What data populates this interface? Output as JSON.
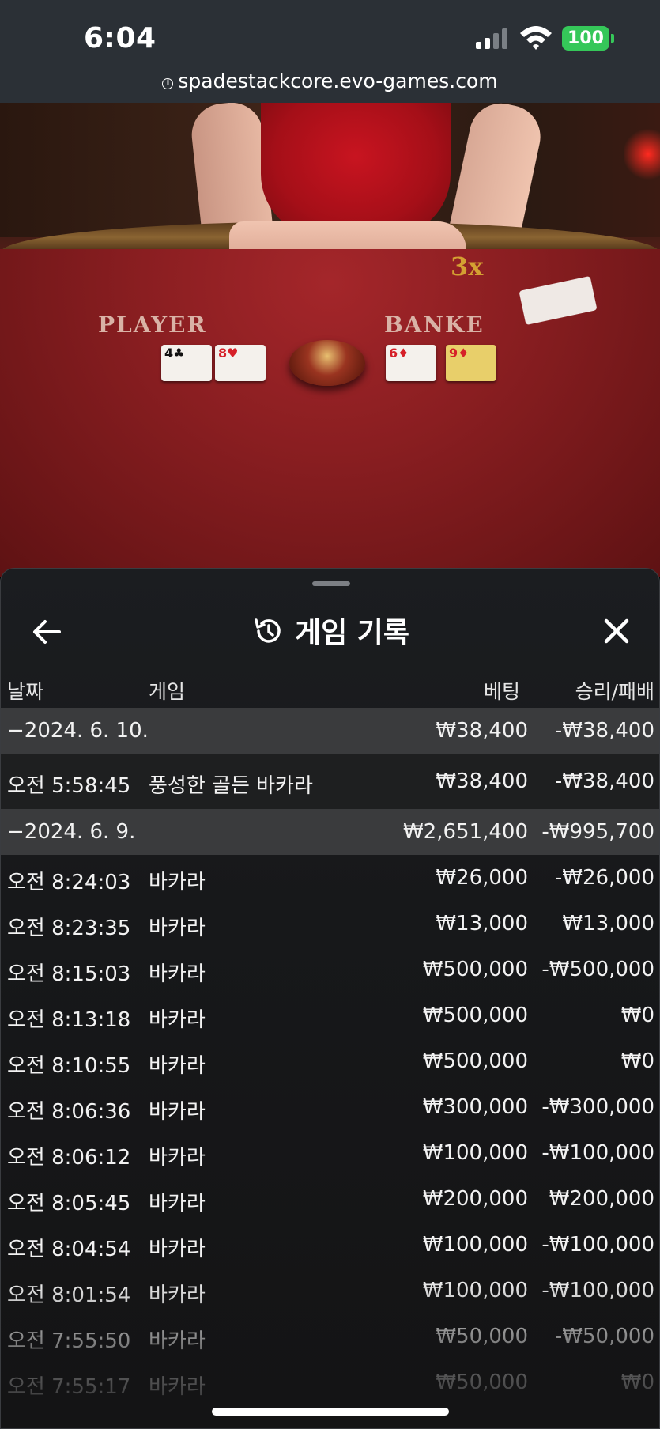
{
  "status_bar": {
    "time": "6:04",
    "battery": "100",
    "url": "spadestackcore.evo-games.com",
    "battery_color": "#35c759"
  },
  "scene": {
    "player_label": "PLAYER",
    "banker_label": "BANKE",
    "multiplier": "3x",
    "player_cards": [
      "4♣",
      "8♥"
    ],
    "banker_cards": [
      "6♦",
      "9♦"
    ]
  },
  "panel": {
    "title": "게임 기록",
    "back_icon": "arrow-left-icon",
    "close_icon": "close-icon",
    "history_icon": "history-icon",
    "columns": {
      "date": "날짜",
      "game": "게임",
      "bet": "베팅",
      "result": "승리/패배"
    },
    "days": [
      {
        "date": "−2024. 6. 10.",
        "bet": "₩38,400",
        "result": "-₩38,400",
        "rows": [
          {
            "time": "오전 5:58:45",
            "game": "풍성한 골든 바카라",
            "bet": "₩38,400",
            "result": "-₩38,400"
          }
        ]
      },
      {
        "date": "−2024. 6. 9.",
        "bet": "₩2,651,400",
        "result": "-₩995,700",
        "rows": [
          {
            "time": "오전 8:24:03",
            "game": "바카라",
            "bet": "₩26,000",
            "result": "-₩26,000"
          },
          {
            "time": "오전 8:23:35",
            "game": "바카라",
            "bet": "₩13,000",
            "result": "₩13,000"
          },
          {
            "time": "오전 8:15:03",
            "game": "바카라",
            "bet": "₩500,000",
            "result": "-₩500,000"
          },
          {
            "time": "오전 8:13:18",
            "game": "바카라",
            "bet": "₩500,000",
            "result": "₩0"
          },
          {
            "time": "오전 8:10:55",
            "game": "바카라",
            "bet": "₩500,000",
            "result": "₩0"
          },
          {
            "time": "오전 8:06:36",
            "game": "바카라",
            "bet": "₩300,000",
            "result": "-₩300,000"
          },
          {
            "time": "오전 8:06:12",
            "game": "바카라",
            "bet": "₩100,000",
            "result": "-₩100,000"
          },
          {
            "time": "오전 8:05:45",
            "game": "바카라",
            "bet": "₩200,000",
            "result": "₩200,000"
          },
          {
            "time": "오전 8:04:54",
            "game": "바카라",
            "bet": "₩100,000",
            "result": "-₩100,000"
          },
          {
            "time": "오전 8:01:54",
            "game": "바카라",
            "bet": "₩100,000",
            "result": "-₩100,000"
          },
          {
            "time": "오전 7:55:50",
            "game": "바카라",
            "bet": "₩50,000",
            "result": "-₩50,000"
          },
          {
            "time": "오전 7:55:17",
            "game": "바카라",
            "bet": "₩50,000",
            "result": "₩0"
          }
        ]
      }
    ]
  }
}
